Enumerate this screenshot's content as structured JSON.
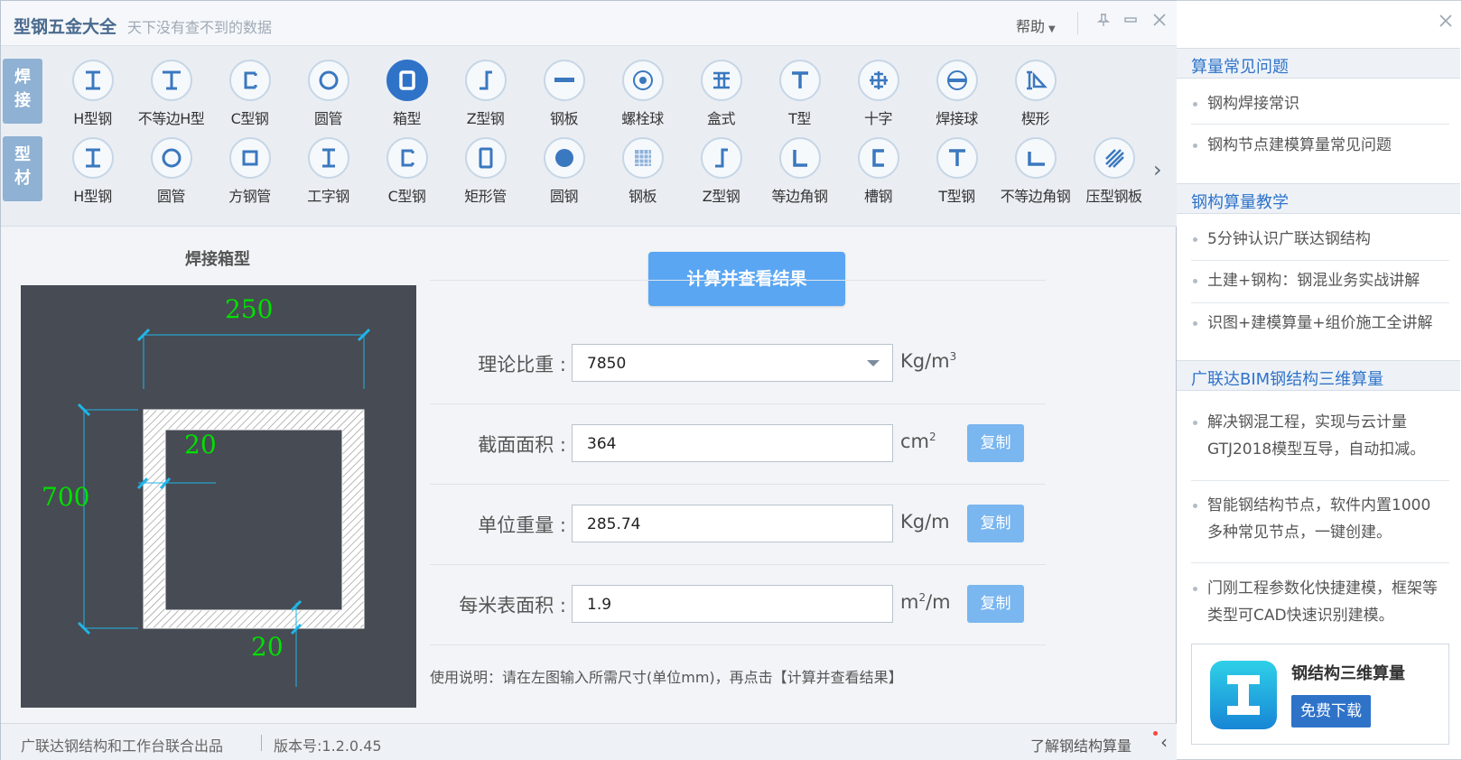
{
  "app": {
    "title": "型钢五金大全",
    "subtitle": "天下没有查不到的数据",
    "help_label": "帮助"
  },
  "toolbar": {
    "categories": [
      {
        "label_top": "焊",
        "label_bottom": "接"
      },
      {
        "label_top": "型",
        "label_bottom": "材"
      }
    ],
    "welded_items": [
      {
        "label": "H型钢",
        "icon": "h-beam-icon"
      },
      {
        "label": "不等边H型",
        "icon": "unequal-h-beam-icon"
      },
      {
        "label": "C型钢",
        "icon": "c-channel-icon"
      },
      {
        "label": "圆管",
        "icon": "round-tube-icon"
      },
      {
        "label": "箱型",
        "icon": "box-section-icon"
      },
      {
        "label": "Z型钢",
        "icon": "z-section-icon"
      },
      {
        "label": "钢板",
        "icon": "steel-plate-icon"
      },
      {
        "label": "螺栓球",
        "icon": "bolt-ball-icon"
      },
      {
        "label": "盒式",
        "icon": "box-type-icon"
      },
      {
        "label": "T型",
        "icon": "t-section-icon"
      },
      {
        "label": "十字",
        "icon": "cross-section-icon"
      },
      {
        "label": "焊接球",
        "icon": "welded-ball-icon"
      },
      {
        "label": "楔形",
        "icon": "wedge-icon"
      }
    ],
    "profile_items": [
      {
        "label": "H型钢",
        "icon": "h-beam-icon"
      },
      {
        "label": "圆管",
        "icon": "round-tube-icon"
      },
      {
        "label": "方钢管",
        "icon": "square-tube-icon"
      },
      {
        "label": "工字钢",
        "icon": "i-beam-icon"
      },
      {
        "label": "C型钢",
        "icon": "c-channel-icon"
      },
      {
        "label": "矩形管",
        "icon": "rect-tube-icon"
      },
      {
        "label": "圆钢",
        "icon": "round-bar-icon"
      },
      {
        "label": "钢板",
        "icon": "checker-plate-icon"
      },
      {
        "label": "Z型钢",
        "icon": "z-section-icon"
      },
      {
        "label": "等边角钢",
        "icon": "equal-angle-icon"
      },
      {
        "label": "槽钢",
        "icon": "channel-icon"
      },
      {
        "label": "T型钢",
        "icon": "t-section-icon"
      },
      {
        "label": "不等边角钢",
        "icon": "unequal-angle-icon"
      },
      {
        "label": "压型钢板",
        "icon": "profiled-plate-icon"
      }
    ],
    "active_item": "箱型"
  },
  "drawing": {
    "title": "焊接箱型",
    "width": "250",
    "height": "700",
    "side_thickness": "20",
    "bottom_thickness": "20"
  },
  "form": {
    "calc_button": "计算并查看结果",
    "fields": [
      {
        "label": "理论比重 :",
        "value": "7850",
        "unit_base": "Kg/m",
        "unit_sup": "3",
        "unit_tail": "",
        "has_copy": false
      },
      {
        "label": "截面面积 :",
        "value": "364",
        "unit_base": "cm",
        "unit_sup": "2",
        "unit_tail": "",
        "has_copy": true
      },
      {
        "label": "单位重量 :",
        "value": "285.74",
        "unit_base": "Kg/m",
        "unit_sup": "",
        "unit_tail": "",
        "has_copy": true
      },
      {
        "label": "每米表面积 :",
        "value": "1.9",
        "unit_base": "m",
        "unit_sup": "2",
        "unit_tail": "/m",
        "has_copy": true
      }
    ],
    "copy_label": "复制",
    "usage_note": "使用说明：请在左图输入所需尺寸(单位mm)，再点击【计算并查看结果】"
  },
  "statusbar": {
    "producer": "广联达钢结构和工作台联合出品",
    "version": "版本号:1.2.0.45",
    "learn_more": "了解钢结构算量"
  },
  "sidepanel": {
    "sections": [
      {
        "title": "算量常见问题",
        "items": [
          "钢构焊接常识",
          "钢构节点建模算量常见问题"
        ]
      },
      {
        "title": "钢构算量教学",
        "items": [
          "5分钟认识广联达钢结构",
          "土建+钢构：钢混业务实战讲解",
          "识图+建模算量+组价施工全讲解"
        ]
      },
      {
        "title": "广联达BIM钢结构三维算量",
        "items": [
          "解决钢混工程，实现与云计量GTJ2018模型互导，自动扣减。",
          "智能钢结构节点，软件内置1000多种常见节点，一键创建。",
          "门刚工程参数化快捷建模，框架等 类型可CAD快速识别建模。"
        ]
      }
    ],
    "ad": {
      "title": "钢结构三维算量",
      "button": "免费下载"
    }
  },
  "colors": {
    "accent": "#2f73c9",
    "button": "#5aa6f3",
    "copy_button": "#7ab6ef",
    "drawing_bg": "#474b53",
    "dimension_text": "#00e000",
    "dimension_line": "#1fb6e8"
  }
}
